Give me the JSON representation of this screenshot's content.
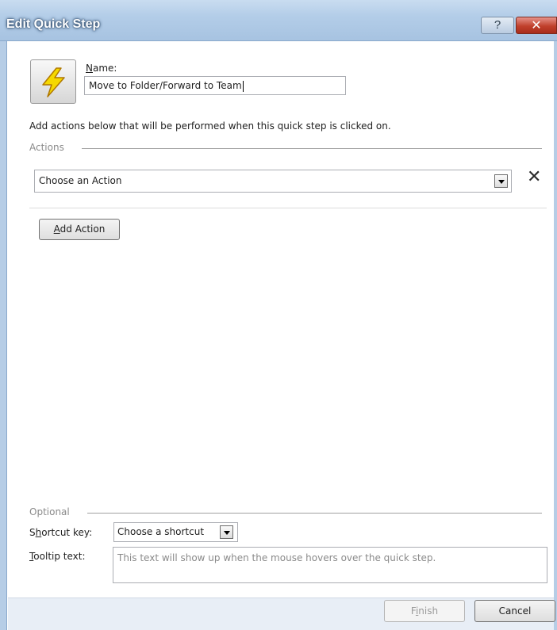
{
  "window": {
    "title": "Edit Quick Step",
    "help_label": "?",
    "close_label": "✕"
  },
  "name": {
    "label_accel": "N",
    "label_rest": "ame:",
    "value": "Move to Folder/Forward to Team"
  },
  "description": "Add actions below that will be performed when this quick step is clicked on.",
  "actions": {
    "section_label": "Actions",
    "selected_value": "Choose an Action",
    "remove_label": "✕",
    "add_accel": "A",
    "add_rest": "dd Action"
  },
  "optional": {
    "section_label": "Optional",
    "shortcut_label_pre": "S",
    "shortcut_label_accel": "h",
    "shortcut_label_post": "ortcut key:",
    "shortcut_value": "Choose a shortcut",
    "tooltip_label_accel": "T",
    "tooltip_label_rest": "ooltip text:",
    "tooltip_placeholder": "This text will show up when the mouse hovers over the quick step."
  },
  "footer": {
    "finish_pre": "F",
    "finish_accel": "i",
    "finish_post": "nish",
    "cancel_label": "Cancel"
  },
  "colors": {
    "titlebar": "#b3cde8",
    "close": "#c0402c",
    "lightning_fill": "#f5d800",
    "lightning_stroke": "#b07800"
  }
}
